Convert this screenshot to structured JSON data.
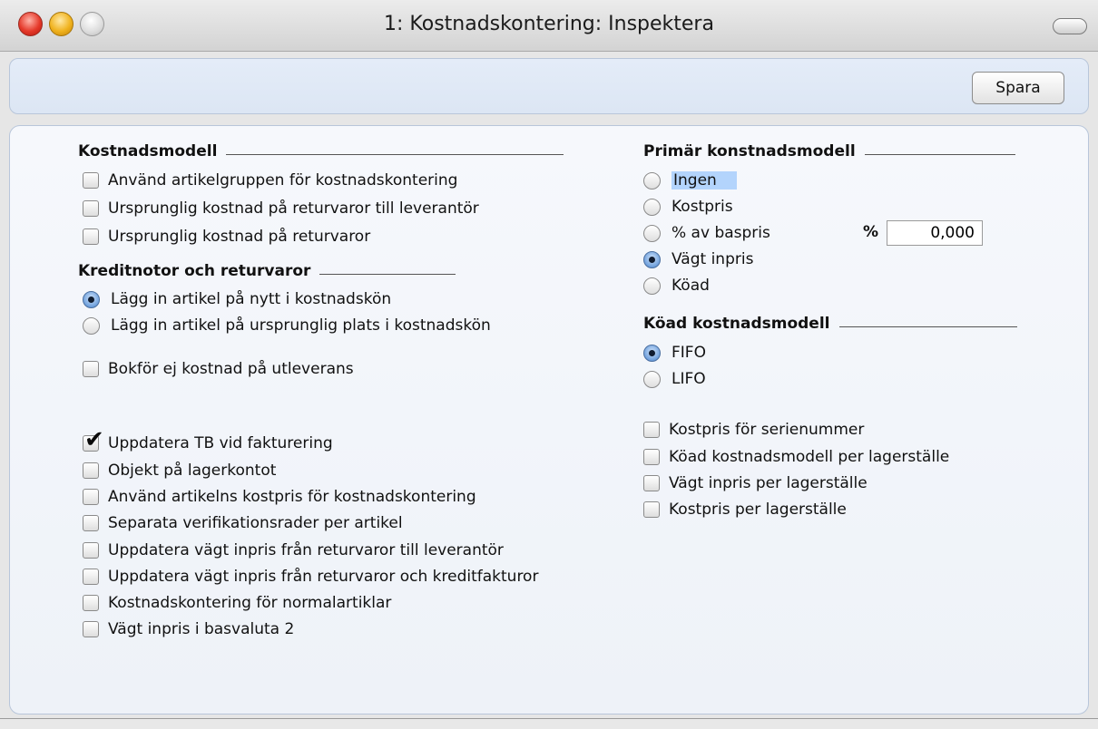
{
  "window": {
    "title": "1: Kostnadskontering: Inspektera"
  },
  "toolbar": {
    "save_label": "Spara"
  },
  "left": {
    "cost_model": {
      "heading": "Kostnadsmodell",
      "items": [
        {
          "label": "Använd artikelgruppen för kostnadskontering",
          "checked": false
        },
        {
          "label": "Ursprunglig kostnad på returvaror till leverantör",
          "checked": false
        },
        {
          "label": "Ursprunglig kostnad på returvaror",
          "checked": false
        }
      ]
    },
    "credit_notes": {
      "heading": "Kreditnotor och returvaror",
      "options": [
        {
          "label": "Lägg in artikel på nytt i kostnadskön",
          "selected": true
        },
        {
          "label": "Lägg in artikel på ursprunglig plats i kostnadskön",
          "selected": false
        }
      ]
    },
    "no_cost_delivery": {
      "label": "Bokför ej kostnad på utleverans",
      "checked": false
    },
    "misc": [
      {
        "label": "Uppdatera TB vid fakturering",
        "checked": true
      },
      {
        "label": "Objekt på lagerkontot",
        "checked": false
      },
      {
        "label": "Använd artikelns kostpris för kostnadskontering",
        "checked": false
      },
      {
        "label": "Separata verifikationsrader per artikel",
        "checked": false
      },
      {
        "label": "Uppdatera vägt inpris från returvaror till leverantör",
        "checked": false
      },
      {
        "label": "Uppdatera vägt inpris från returvaror och kreditfakturor",
        "checked": false
      },
      {
        "label": "Kostnadskontering för normalartiklar",
        "checked": false
      },
      {
        "label": "Vägt inpris i basvaluta 2",
        "checked": false
      }
    ]
  },
  "right": {
    "primary_model": {
      "heading": "Primär konstnadsmodell",
      "options": [
        {
          "label": "Ingen",
          "selected": false
        },
        {
          "label": "Kostpris",
          "selected": false
        },
        {
          "label": "% av baspris",
          "selected": false
        },
        {
          "label": "Vägt inpris",
          "selected": true
        },
        {
          "label": "Köad",
          "selected": false
        }
      ],
      "percent_symbol": "%",
      "percent_value": "0,000"
    },
    "queued_model": {
      "heading": "Köad kostnadsmodell",
      "options": [
        {
          "label": "FIFO",
          "selected": true
        },
        {
          "label": "LIFO",
          "selected": false
        }
      ]
    },
    "extra": [
      {
        "label": "Kostpris för serienummer",
        "checked": false
      },
      {
        "label": "Köad kostnadsmodell per lagerställe",
        "checked": false
      },
      {
        "label": "Vägt inpris per lagerställe",
        "checked": false
      },
      {
        "label": "Kostpris per lagerställe",
        "checked": false
      }
    ]
  }
}
